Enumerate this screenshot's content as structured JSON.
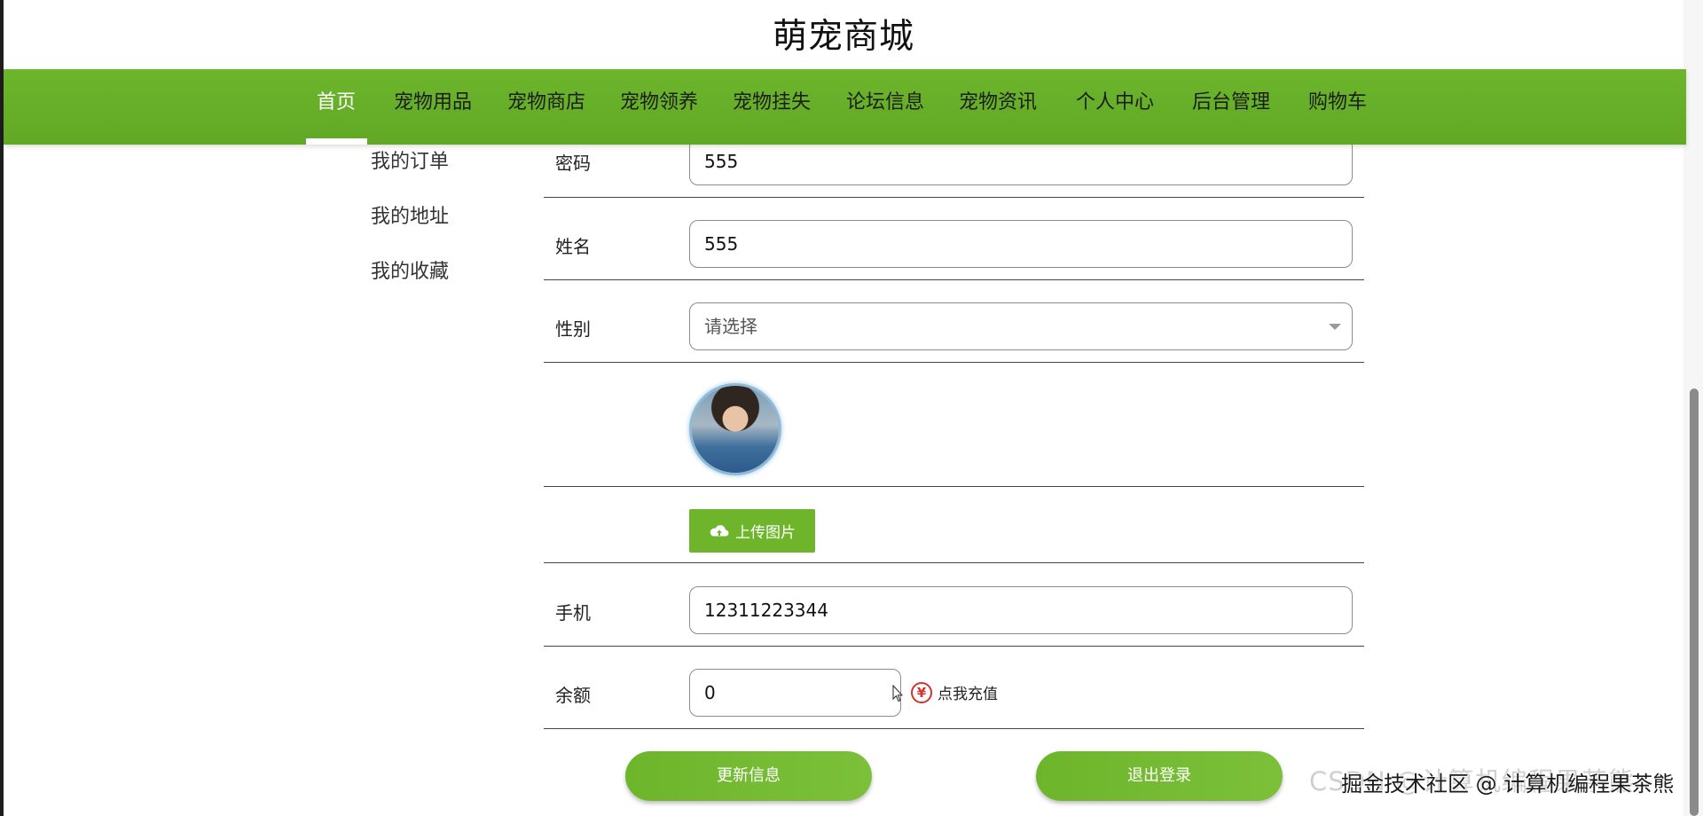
{
  "site": {
    "title": "萌宠商城"
  },
  "nav": {
    "items": [
      {
        "label": "首页"
      },
      {
        "label": "宠物用品"
      },
      {
        "label": "宠物商店"
      },
      {
        "label": "宠物领养"
      },
      {
        "label": "宠物挂失"
      },
      {
        "label": "论坛信息"
      },
      {
        "label": "宠物资讯"
      },
      {
        "label": "个人中心"
      },
      {
        "label": "后台管理"
      },
      {
        "label": "购物车"
      }
    ],
    "active": "首页"
  },
  "sidebar": {
    "items": [
      {
        "label": "我的订单"
      },
      {
        "label": "我的地址"
      },
      {
        "label": "我的收藏"
      }
    ]
  },
  "form": {
    "password": {
      "label": "密码",
      "value": "555"
    },
    "name": {
      "label": "姓名",
      "value": "555"
    },
    "gender": {
      "label": "性别",
      "placeholder": "请选择"
    },
    "upload": {
      "label": "上传图片"
    },
    "phone": {
      "label": "手机",
      "value": "12311223344"
    },
    "balance": {
      "label": "余额",
      "value": "0",
      "recharge_label": "点我充值"
    }
  },
  "actions": {
    "update_label": "更新信息",
    "logout_label": "退出登录"
  },
  "watermark": {
    "back": "CSDN @计算机编程果茶熊",
    "front": "掘金技术社区 @ 计算机编程果茶熊"
  },
  "colors": {
    "nav_green": "#6cb52c",
    "button_green": "#6eb52c",
    "recharge_red": "#d0342c"
  },
  "icons": [
    "cloud-upload-icon",
    "yen-icon",
    "mouse-pointer-icon"
  ]
}
